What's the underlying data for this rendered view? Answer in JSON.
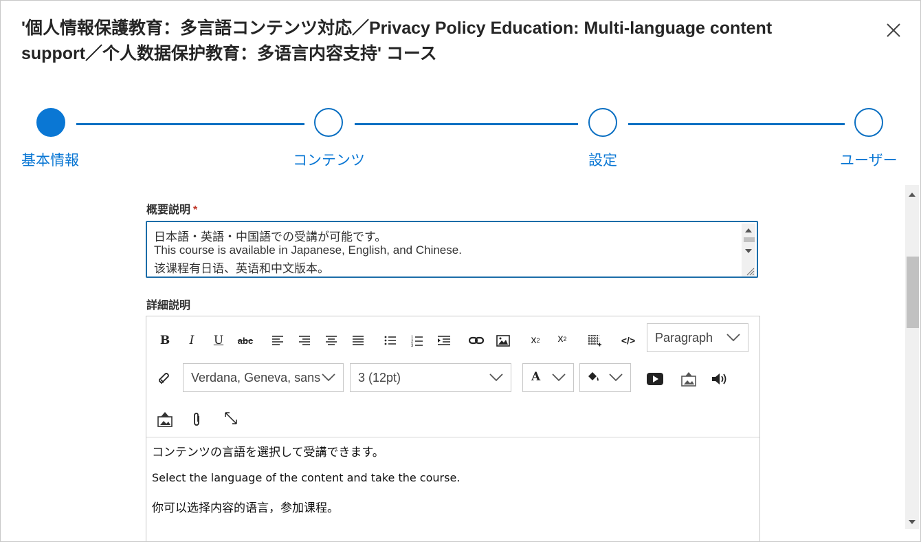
{
  "dialog": {
    "title_line1": "'個人情報保護教育：多言語コンテンツ対応／Privacy Policy Education: Multi-language content",
    "title_line2": "support／个人数据保护教育：多语言内容支持' コース",
    "close_icon": "close-icon"
  },
  "stepper": {
    "steps": [
      {
        "label": "基本情報",
        "state": "active"
      },
      {
        "label": "コンテンツ",
        "state": "inactive"
      },
      {
        "label": "設定",
        "state": "inactive"
      },
      {
        "label": "ユーザー",
        "state": "inactive"
      }
    ],
    "accent_color": "#0a77d4"
  },
  "form": {
    "summary": {
      "label": "概要説明",
      "required_mark": "*",
      "lines": [
        "日本語・英語・中国語での受講が可能です。",
        "This course is available in Japanese, English, and Chinese.",
        "该课程有日语、英语和中文版本。"
      ]
    },
    "details": {
      "label": "詳細説明",
      "toolbar": {
        "format_select": "Paragraph",
        "font_select": "Verdana, Geneva, sans",
        "size_select": "3 (12pt)",
        "icons": [
          "bold-icon",
          "italic-icon",
          "underline-icon",
          "strikethrough-icon",
          "align-left-icon",
          "align-right-icon",
          "align-center-icon",
          "align-justify-icon",
          "bullet-list-icon",
          "numbered-list-icon",
          "indent-icon",
          "link-icon",
          "image-icon",
          "subscript-icon",
          "superscript-icon",
          "table-icon",
          "code-icon",
          "eraser-icon",
          "font-color-icon",
          "highlight-icon",
          "video-icon",
          "upload-image-icon",
          "audio-icon",
          "upload-icon",
          "attachment-icon",
          "fullscreen-icon"
        ]
      },
      "content": [
        "コンテンツの言語を選択して受講できます。",
        "Select the language of the content and take the course.",
        "你可以选择内容的语言，参加课程。"
      ]
    }
  }
}
